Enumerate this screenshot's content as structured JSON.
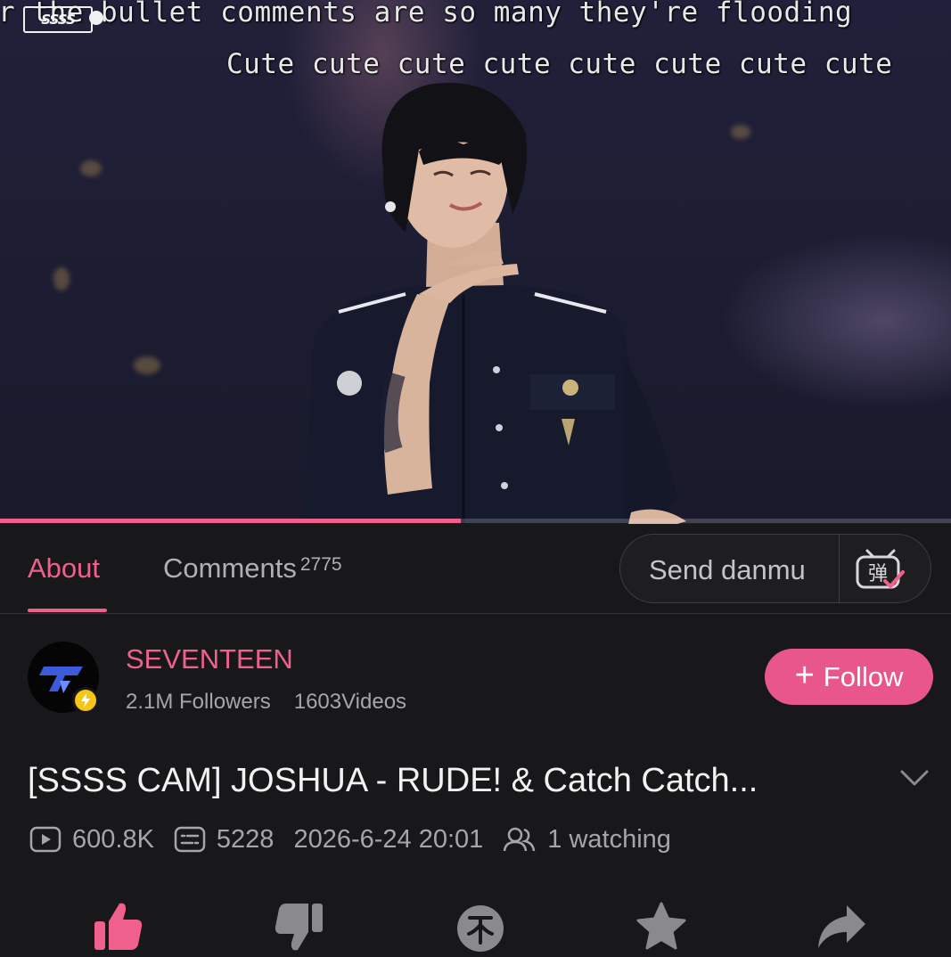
{
  "video": {
    "danmu_line_1": "r the bullet comments are so many they're flooding",
    "danmu_line_2": "Cute cute cute cute cute cute cute cute",
    "logo_text": "SSSS",
    "progress": 0.485
  },
  "tabs": {
    "about_label": "About",
    "comments_label": "Comments",
    "comments_count": "2775",
    "danmu_placeholder": "Send danmu",
    "danmu_toggle_glyph": "弹"
  },
  "channel": {
    "name": "SEVENTEEN",
    "followers": "2.1M Followers",
    "videos": "1603Videos",
    "follow_label": "Follow"
  },
  "video_info": {
    "title": "[SSSS CAM] JOSHUA - RUDE! & Catch Catch...",
    "views": "600.8K",
    "danmu_count": "5228",
    "date": "2026-6-24 20:01",
    "watching": "1 watching"
  },
  "actions": [
    {
      "name": "like",
      "icon": "thumbs-up-icon",
      "active": true
    },
    {
      "name": "dislike",
      "icon": "thumbs-down-icon",
      "active": false
    },
    {
      "name": "coin",
      "icon": "coin-icon",
      "active": false
    },
    {
      "name": "favorite",
      "icon": "star-icon",
      "active": false
    },
    {
      "name": "share",
      "icon": "share-icon",
      "active": false
    }
  ],
  "colors": {
    "accent": "#f0608c",
    "follow_button": "#e9578a",
    "background": "#18181a",
    "muted_text": "#a6a6aa",
    "verified_badge": "#f5c518"
  }
}
